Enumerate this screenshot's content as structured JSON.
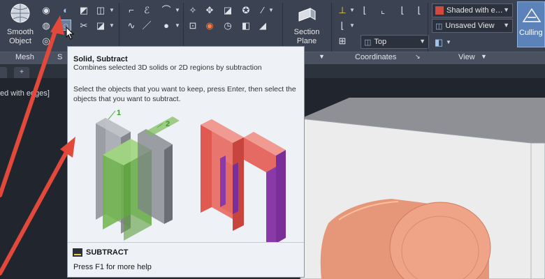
{
  "ribbon": {
    "smooth_object": "Smooth\nObject",
    "section_plane": "Section\nPlane",
    "visual_style": "Shaded with e…",
    "saved_view": "Unsaved View",
    "view_direction": "Top",
    "culling": "Culling",
    "panels": {
      "mesh": "Mesh",
      "solid_editing_partial": "S",
      "coordinates": "Coordinates",
      "view": "View"
    }
  },
  "viewport": {
    "style_label": "ed with edges]"
  },
  "tabs": {
    "new_tab": "+"
  },
  "tooltip": {
    "title": "Solid, Subtract",
    "description": "Combines selected 3D solids or 2D regions by subtraction",
    "instructions": "Select the objects that you want to keep, press Enter, then select the objects that you want to subtract.",
    "label_1": "1",
    "label_2": "2",
    "command": "SUBTRACT",
    "help": "Press F1 for more help"
  },
  "colors": {
    "ribbon_bg": "#3b4352",
    "viewport_bg": "#21262e",
    "tooltip_bg": "#eef1f5",
    "arrow_red": "#e3493b",
    "cylinder_orange": "#e8987a",
    "box_light": "#e9e9e9",
    "subtract_green": "#7ebc5a",
    "result_red": "#e46a63",
    "result_purple": "#8a3aa8",
    "culling_blue": "#5b82b9"
  },
  "icons": [
    "smooth-object-icon",
    "section-plane-icon",
    "solid-subtract-icon",
    "ucs-icon",
    "view-cube-icon",
    "cursor-icon"
  ]
}
